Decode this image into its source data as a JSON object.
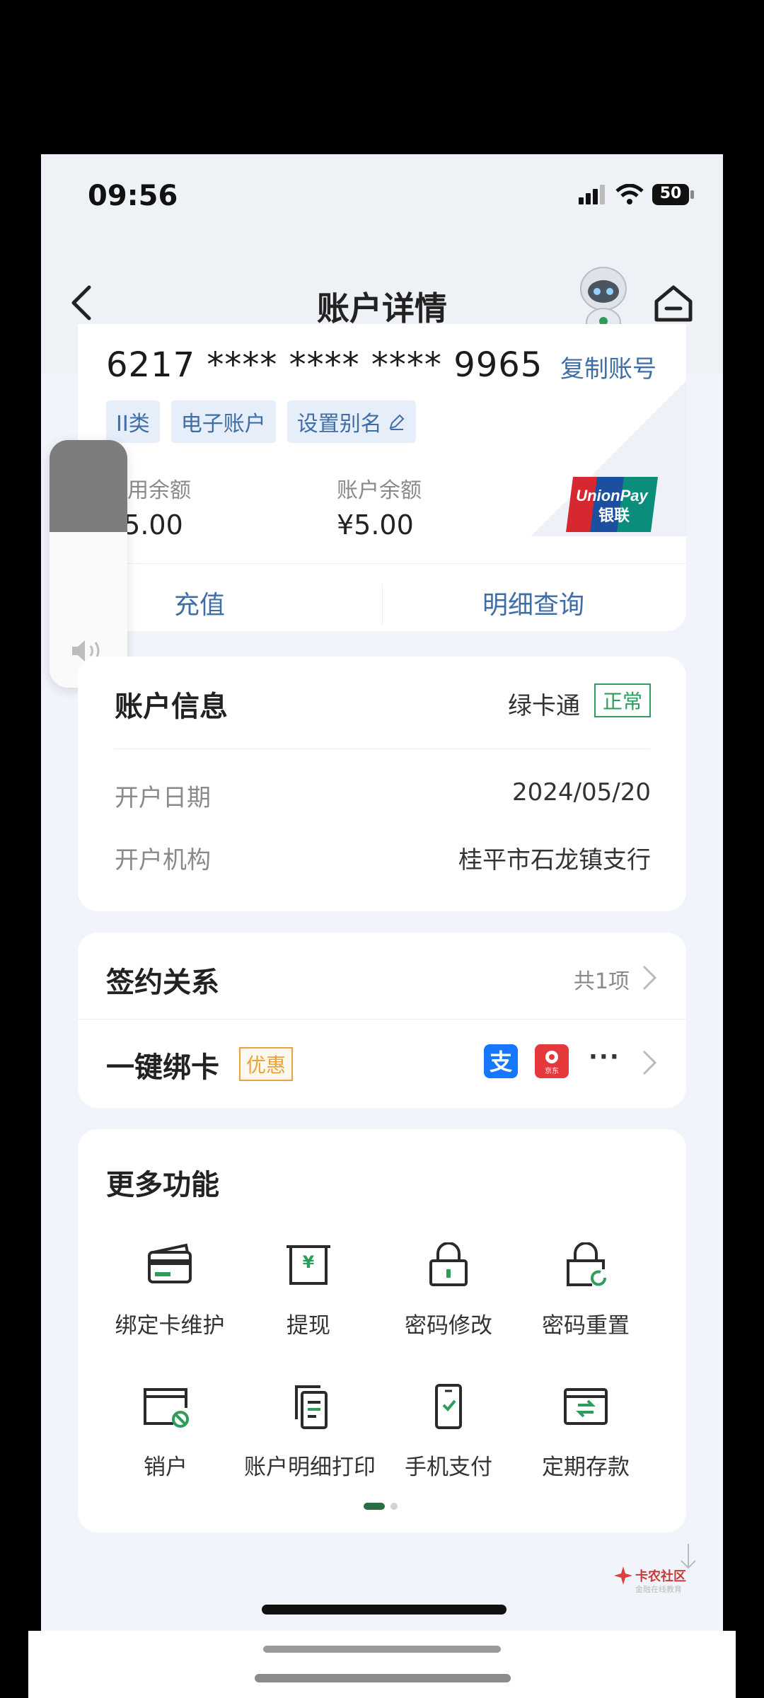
{
  "status_bar": {
    "time": "09:56",
    "battery": "50"
  },
  "nav": {
    "title": "账户详情"
  },
  "account_card": {
    "number": "6217 **** **** **** 9965",
    "copy_label": "复制账号",
    "tags": [
      "II类",
      "电子账户",
      "设置别名"
    ],
    "available_label": "可用余额",
    "available_value": "¥5.00",
    "balance_label": "账户余额",
    "balance_value": "¥5.00",
    "actions": [
      "充值",
      "明细查询"
    ]
  },
  "volume_overlay": {
    "level": 0.37
  },
  "account_info": {
    "title": "账户信息",
    "card_type": "绿卡通",
    "status": "正常",
    "rows": [
      {
        "label": "开户日期",
        "value": "2024/05/20"
      },
      {
        "label": "开户机构",
        "value": "桂平市石龙镇支行"
      }
    ]
  },
  "sign": {
    "title": "签约关系",
    "count": "共1项",
    "bind_title": "一键绑卡",
    "promo": "优惠",
    "more": "···",
    "apps": [
      {
        "icon": "alipay-icon",
        "color": "#1677ff"
      },
      {
        "icon": "jd-icon",
        "color": "#e4393c",
        "text": "京东"
      }
    ]
  },
  "more_functions": {
    "title": "更多功能",
    "items": [
      {
        "label": "绑定卡维护",
        "icon": "card-icon"
      },
      {
        "label": "提现",
        "icon": "withdraw-icon"
      },
      {
        "label": "密码修改",
        "icon": "lock-icon"
      },
      {
        "label": "密码重置",
        "icon": "lock-reset-icon"
      },
      {
        "label": "销户",
        "icon": "card-cancel-icon"
      },
      {
        "label": "账户明细打印",
        "icon": "document-icon"
      },
      {
        "label": "手机支付",
        "icon": "phone-icon"
      },
      {
        "label": "定期存款",
        "icon": "deposit-icon"
      }
    ],
    "page_count": 2,
    "active_page": 1
  },
  "watermark": {
    "text": "卡农社区",
    "subtext": "金融在线教育"
  }
}
